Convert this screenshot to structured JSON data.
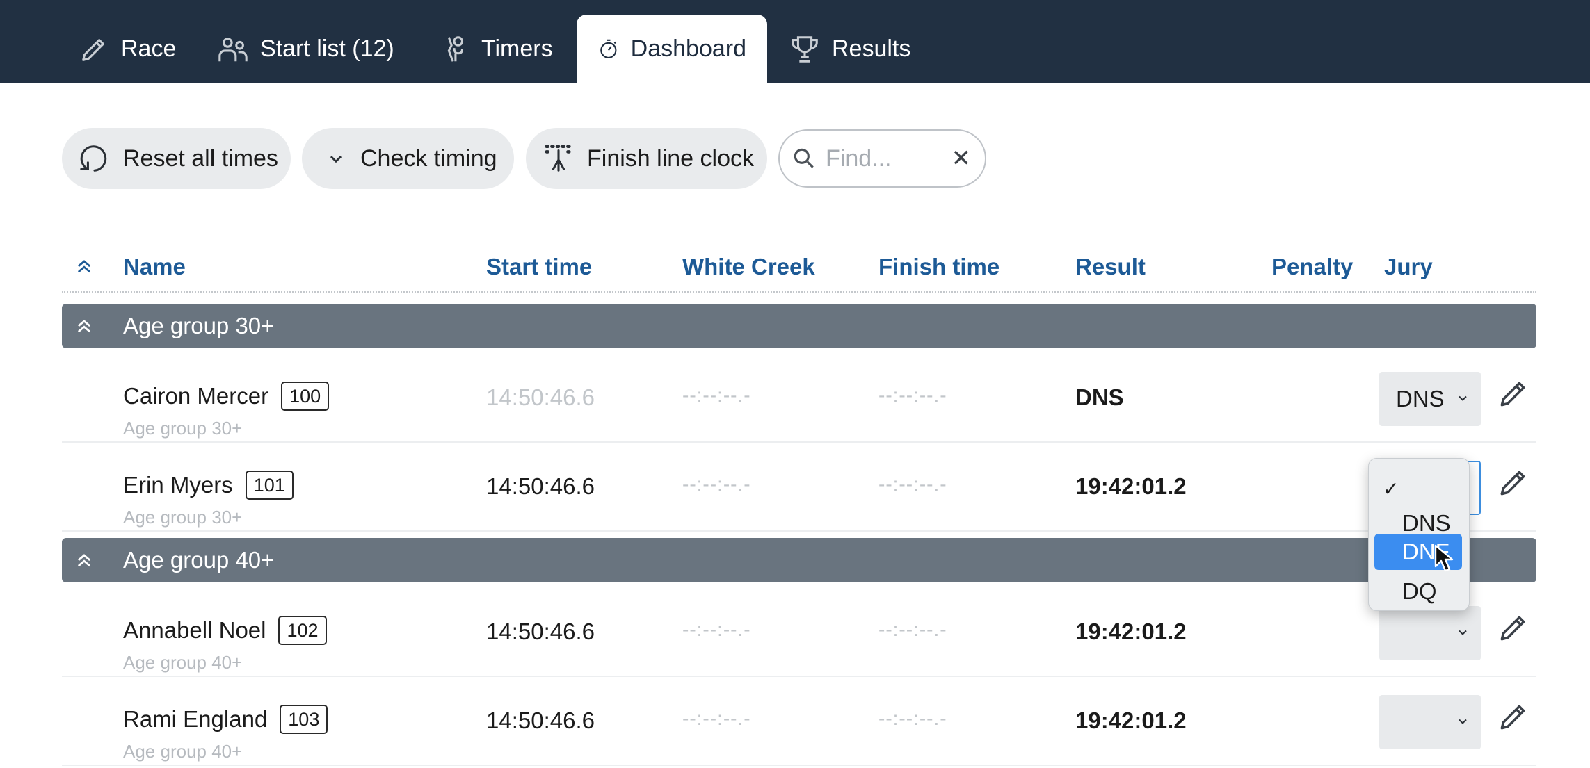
{
  "nav": {
    "tabs": [
      {
        "label": "Race",
        "icon": "pencil-icon"
      },
      {
        "label": "Start list (12)",
        "icon": "users-icon"
      },
      {
        "label": "Timers",
        "icon": "timer-person-icon"
      },
      {
        "label": "Dashboard",
        "icon": "stopwatch-icon",
        "active": true
      },
      {
        "label": "Results",
        "icon": "trophy-icon"
      }
    ]
  },
  "toolbar": {
    "reset_label": "Reset all times",
    "check_label": "Check timing",
    "finish_label": "Finish line clock",
    "search_placeholder": "Find..."
  },
  "table": {
    "headers": {
      "name": "Name",
      "start": "Start time",
      "split": "White Creek",
      "finish": "Finish time",
      "result": "Result",
      "penalty": "Penalty",
      "jury": "Jury"
    },
    "groups": [
      {
        "name": "Age group 30+",
        "rows": [
          {
            "name": "Cairon Mercer",
            "bib": "100",
            "group": "Age group 30+",
            "start": "14:50:46.6",
            "split": "--:--:--.-",
            "finish": "--:--:--.-",
            "result": "DNS",
            "jury": "DNS"
          },
          {
            "name": "Erin Myers",
            "bib": "101",
            "group": "Age group 30+",
            "start": "14:50:46.6",
            "split": "--:--:--.-",
            "finish": "--:--:--.-",
            "result": "19:42:01.2",
            "jury": ""
          }
        ]
      },
      {
        "name": "Age group 40+",
        "rows": [
          {
            "name": "Annabell Noel",
            "bib": "102",
            "group": "Age group 40+",
            "start": "14:50:46.6",
            "split": "--:--:--.-",
            "finish": "--:--:--.-",
            "result": "19:42:01.2",
            "jury": ""
          },
          {
            "name": "Rami England",
            "bib": "103",
            "group": "Age group 40+",
            "start": "14:50:46.6",
            "split": "--:--:--.-",
            "finish": "--:--:--.-",
            "result": "19:42:01.2",
            "jury": ""
          }
        ]
      }
    ]
  },
  "jury_dropdown": {
    "options": [
      "",
      "DNS",
      "DNF",
      "DQ"
    ],
    "checked": "",
    "highlighted": "DNF",
    "check_mark": "✓"
  },
  "colors": {
    "nav_bg": "#213042",
    "header_text": "#1d5a96",
    "group_bg": "#69747f",
    "highlight": "#3b8df0"
  }
}
